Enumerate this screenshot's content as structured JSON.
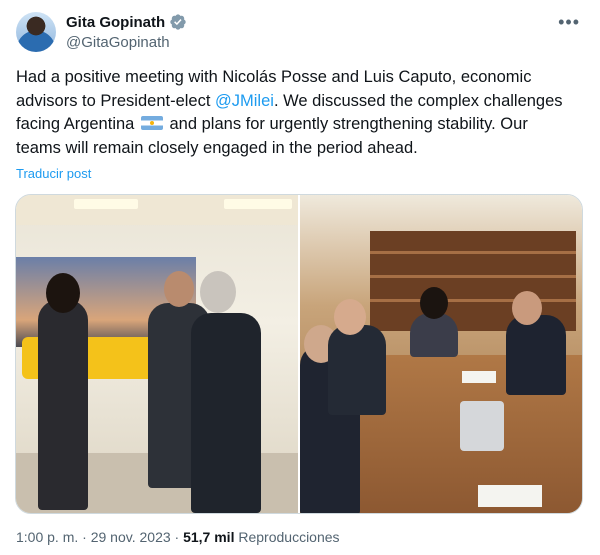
{
  "author": {
    "name": "Gita Gopinath",
    "handle": "@GitaGopinath",
    "verified": true,
    "avatar_icon": "avatar-photo"
  },
  "tweet": {
    "text_part1": "Had a positive meeting with Nicolás Posse and Luis Caputo, economic advisors to President-elect ",
    "mention": "@JMilei",
    "text_part2": ". We discussed the complex challenges facing Argentina ",
    "flag_icon": "argentina-flag-icon",
    "text_part3": " and plans for urgently strengthening stability. Our teams will remain closely engaged in the period ahead."
  },
  "translate_label": "Traducir post",
  "more_icon": "more-icon",
  "media": {
    "count": 2,
    "items": [
      "meeting-photo-left",
      "meeting-photo-right"
    ]
  },
  "meta": {
    "time": "1:00 p. m.",
    "separator": " · ",
    "date": "29 nov. 2023",
    "views_count": "51,7 mil",
    "views_label": "Reproducciones"
  },
  "colors": {
    "link": "#1d9bf0",
    "secondary_text": "#536471",
    "primary_text": "#0f1419",
    "verified_badge": "#829aab"
  }
}
